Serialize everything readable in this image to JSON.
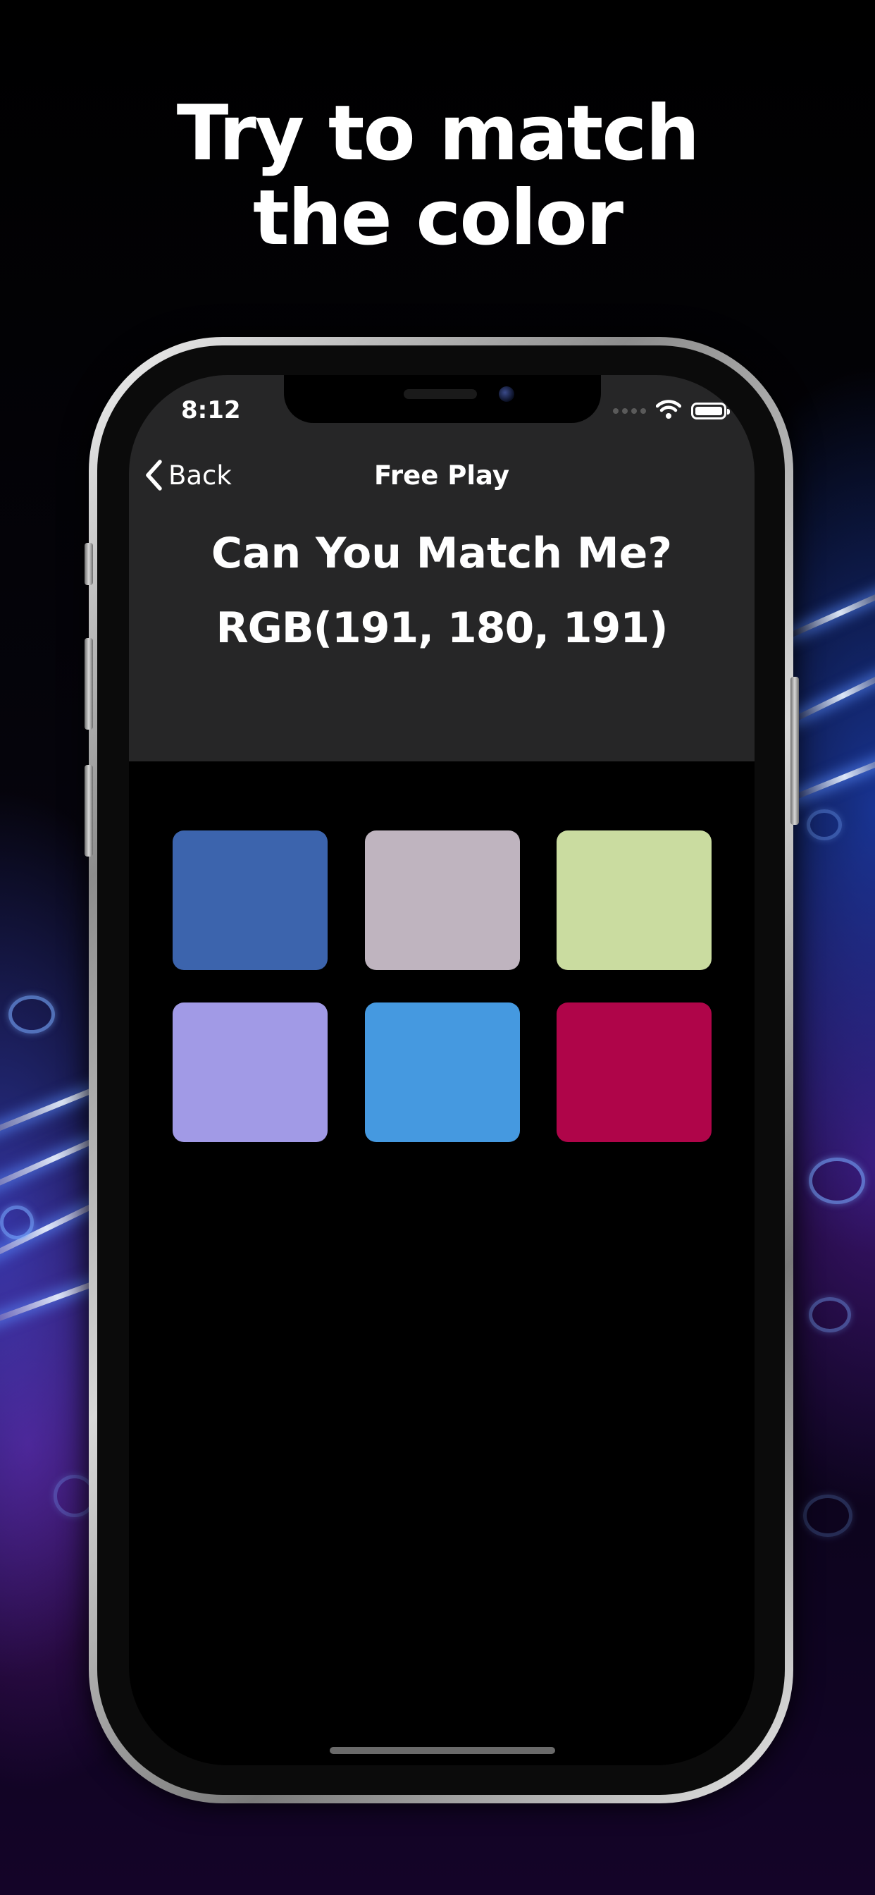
{
  "headline": {
    "line1": "Try to match",
    "line2": "the color"
  },
  "status_bar": {
    "time": "8:12"
  },
  "nav": {
    "back_label": "Back",
    "title": "Free Play"
  },
  "challenge": {
    "prompt": "Can You Match Me?",
    "rgb_label": "RGB(191, 180, 191)"
  },
  "swatches": [
    {
      "color": "#3c64ad"
    },
    {
      "color": "#bfb4bf"
    },
    {
      "color": "#cadca0"
    },
    {
      "color": "#a19ae6"
    },
    {
      "color": "#4599e0"
    },
    {
      "color": "#af0549"
    }
  ],
  "icons": {
    "back": "chevron-left-icon",
    "wifi": "wifi-icon",
    "battery": "battery-icon",
    "signal": "signal-icon"
  },
  "colors": {
    "panel": "#262627",
    "screen_background": "#000000"
  }
}
